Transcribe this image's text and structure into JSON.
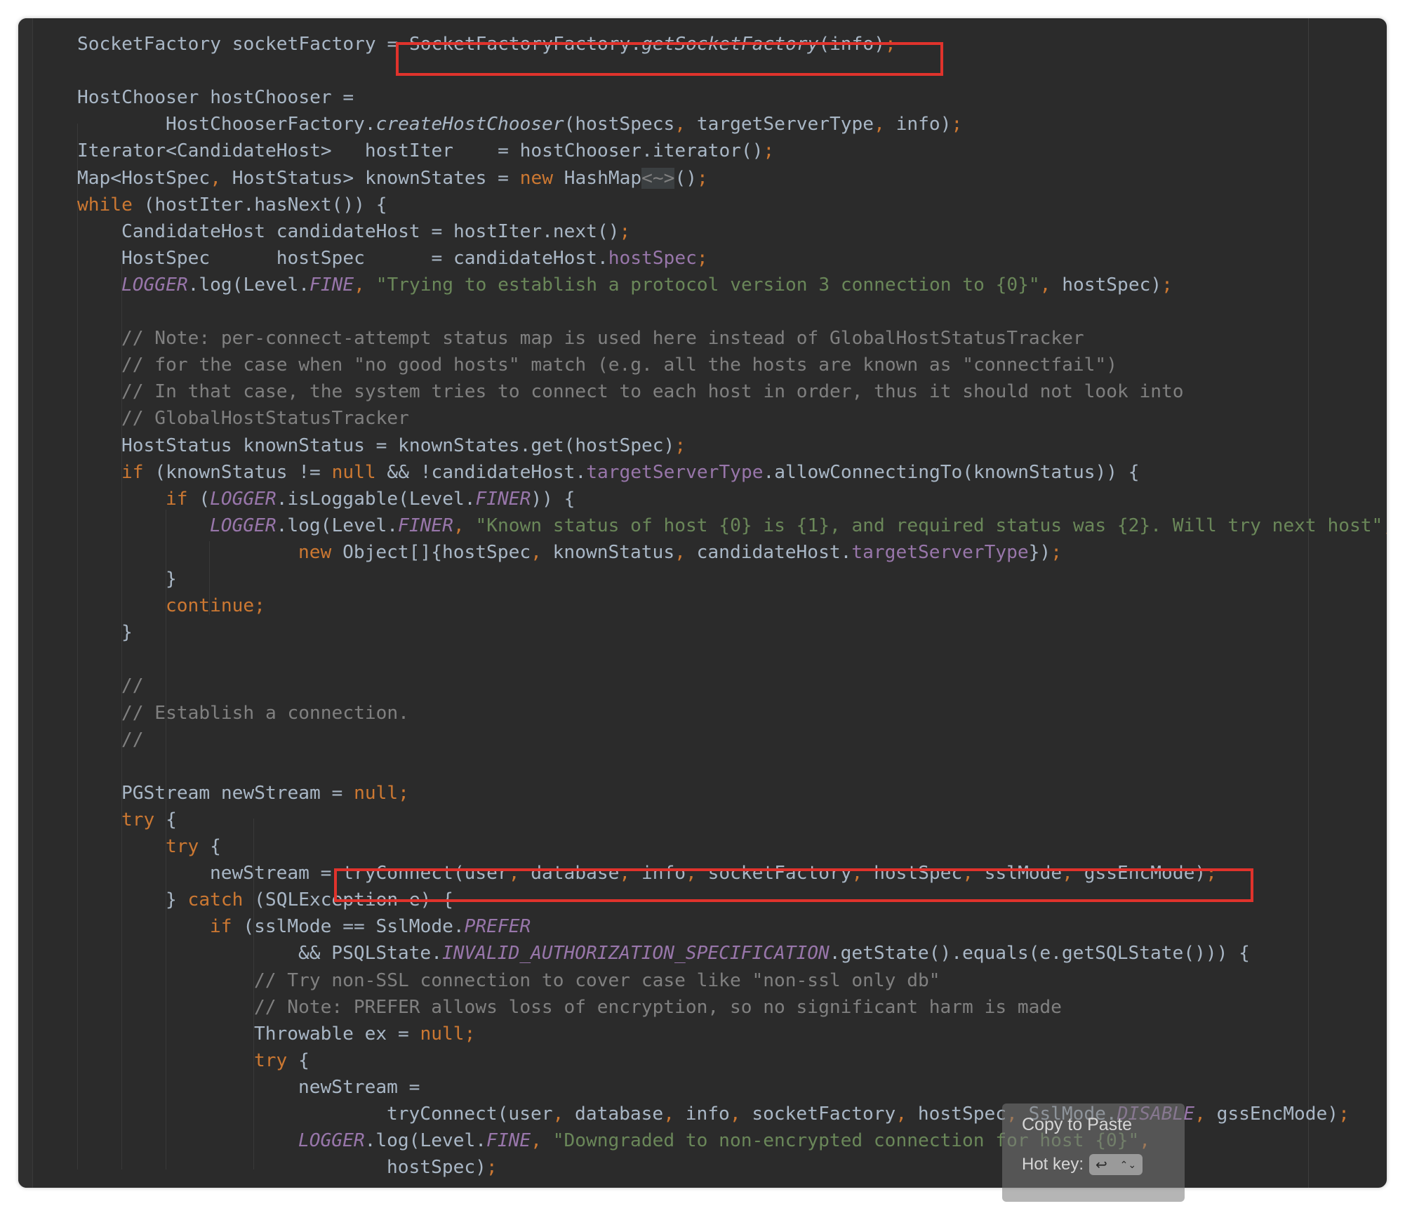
{
  "editor": {
    "lines": [
      {
        "indent": 0,
        "tokens": [
          [
            "SocketFactory socketFactory = ",
            ""
          ],
          [
            "SocketFactoryFactory.",
            ""
          ],
          [
            "getSocketFactory",
            "smeth"
          ],
          [
            "(info)",
            ""
          ],
          [
            ";",
            "kw"
          ]
        ]
      },
      {
        "indent": 0,
        "tokens": []
      },
      {
        "indent": 0,
        "tokens": [
          [
            "HostChooser hostChooser =",
            ""
          ]
        ]
      },
      {
        "indent": 2,
        "tokens": [
          [
            "HostChooserFactory.",
            ""
          ],
          [
            "createHostChooser",
            "smeth"
          ],
          [
            "(hostSpecs",
            ""
          ],
          [
            ",",
            "kw"
          ],
          [
            " targetServerType",
            ""
          ],
          [
            ",",
            "kw"
          ],
          [
            " info)",
            ""
          ],
          [
            ";",
            "kw"
          ]
        ]
      },
      {
        "indent": 0,
        "tokens": [
          [
            "Iterator<CandidateHost>   hostIter    = hostChooser.iterator()",
            ""
          ],
          [
            ";",
            "kw"
          ]
        ]
      },
      {
        "indent": 0,
        "tokens": [
          [
            "Map<HostSpec",
            ""
          ],
          [
            ",",
            "kw"
          ],
          [
            " HostStatus> knownStates = ",
            ""
          ],
          [
            "new",
            "kw"
          ],
          [
            " HashMap",
            ""
          ],
          [
            "<~>",
            "diamond"
          ],
          [
            "()",
            ""
          ],
          [
            ";",
            "kw"
          ]
        ]
      },
      {
        "indent": 0,
        "tokens": [
          [
            "while",
            "kw"
          ],
          [
            " (hostIter.hasNext()) {",
            ""
          ]
        ]
      },
      {
        "indent": 1,
        "tokens": [
          [
            "CandidateHost candidateHost = hostIter.next()",
            ""
          ],
          [
            ";",
            "kw"
          ]
        ]
      },
      {
        "indent": 1,
        "tokens": [
          [
            "HostSpec      hostSpec      = candidateHost.",
            ""
          ],
          [
            "hostSpec",
            "fld"
          ],
          [
            ";",
            "kw"
          ]
        ]
      },
      {
        "indent": 1,
        "tokens": [
          [
            "LOGGER",
            "sfld"
          ],
          [
            ".log(Level.",
            ""
          ],
          [
            "FINE",
            "sfld"
          ],
          [
            ",",
            "kw"
          ],
          [
            " ",
            ""
          ],
          [
            "\"Trying to establish a protocol version 3 connection to {0}\"",
            "str"
          ],
          [
            ",",
            "kw"
          ],
          [
            " hostSpec)",
            ""
          ],
          [
            ";",
            "kw"
          ]
        ]
      },
      {
        "indent": 0,
        "tokens": []
      },
      {
        "indent": 1,
        "tokens": [
          [
            "// Note: per-connect-attempt status map is used here instead of GlobalHostStatusTracker",
            "cmt"
          ]
        ]
      },
      {
        "indent": 1,
        "tokens": [
          [
            "// for the case when \"no good hosts\" match (e.g. all the hosts are known as \"connectfail\")",
            "cmt"
          ]
        ]
      },
      {
        "indent": 1,
        "tokens": [
          [
            "// In that case, the system tries to connect to each host in order, thus it should not look into",
            "cmt"
          ]
        ]
      },
      {
        "indent": 1,
        "tokens": [
          [
            "// GlobalHostStatusTracker",
            "cmt"
          ]
        ]
      },
      {
        "indent": 1,
        "tokens": [
          [
            "HostStatus knownStatus = knownStates.get(hostSpec)",
            ""
          ],
          [
            ";",
            "kw"
          ]
        ]
      },
      {
        "indent": 1,
        "tokens": [
          [
            "if",
            "kw"
          ],
          [
            " (knownStatus != ",
            ""
          ],
          [
            "null",
            "kw"
          ],
          [
            " && !candidateHost.",
            ""
          ],
          [
            "targetServerType",
            "fld"
          ],
          [
            ".allowConnectingTo(knownStatus)) {",
            ""
          ]
        ]
      },
      {
        "indent": 2,
        "tokens": [
          [
            "if",
            "kw"
          ],
          [
            " (",
            ""
          ],
          [
            "LOGGER",
            "sfld"
          ],
          [
            ".isLoggable(Level.",
            ""
          ],
          [
            "FINER",
            "sfld"
          ],
          [
            ")) {",
            ""
          ]
        ]
      },
      {
        "indent": 3,
        "tokens": [
          [
            "LOGGER",
            "sfld"
          ],
          [
            ".log(Level.",
            ""
          ],
          [
            "FINER",
            "sfld"
          ],
          [
            ",",
            "kw"
          ],
          [
            " ",
            ""
          ],
          [
            "\"Known status of host {0} is {1}, and required status was {2}. Will try next host\"",
            "str"
          ],
          [
            ",",
            "kw"
          ]
        ]
      },
      {
        "indent": 5,
        "tokens": [
          [
            "new",
            "kw"
          ],
          [
            " Object[]{hostSpec",
            ""
          ],
          [
            ",",
            "kw"
          ],
          [
            " knownStatus",
            ""
          ],
          [
            ",",
            "kw"
          ],
          [
            " candidateHost.",
            ""
          ],
          [
            "targetServerType",
            "fld"
          ],
          [
            "})",
            ""
          ],
          [
            ";",
            "kw"
          ]
        ]
      },
      {
        "indent": 2,
        "tokens": [
          [
            "}",
            ""
          ]
        ]
      },
      {
        "indent": 2,
        "tokens": [
          [
            "continue;",
            "kw"
          ]
        ]
      },
      {
        "indent": 1,
        "tokens": [
          [
            "}",
            ""
          ]
        ]
      },
      {
        "indent": 0,
        "tokens": []
      },
      {
        "indent": 1,
        "tokens": [
          [
            "//",
            "cmt"
          ]
        ]
      },
      {
        "indent": 1,
        "tokens": [
          [
            "// Establish a connection.",
            "cmt"
          ]
        ]
      },
      {
        "indent": 1,
        "tokens": [
          [
            "//",
            "cmt"
          ]
        ]
      },
      {
        "indent": 0,
        "tokens": []
      },
      {
        "indent": 1,
        "tokens": [
          [
            "PGStream newStream = ",
            ""
          ],
          [
            "null;",
            "kw"
          ]
        ]
      },
      {
        "indent": 1,
        "tokens": [
          [
            "try",
            "kw"
          ],
          [
            " {",
            ""
          ]
        ]
      },
      {
        "indent": 2,
        "tokens": [
          [
            "try",
            "kw"
          ],
          [
            " {",
            ""
          ]
        ]
      },
      {
        "indent": 3,
        "tokens": [
          [
            "newStream = tryConnect(user",
            ""
          ],
          [
            ",",
            "kw"
          ],
          [
            " database",
            ""
          ],
          [
            ",",
            "kw"
          ],
          [
            " info",
            ""
          ],
          [
            ",",
            "kw"
          ],
          [
            " socketFactory",
            ""
          ],
          [
            ",",
            "kw"
          ],
          [
            " hostSpec",
            ""
          ],
          [
            ",",
            "kw"
          ],
          [
            " sslMode",
            ""
          ],
          [
            ",",
            "kw"
          ],
          [
            " gssEncMode)",
            ""
          ],
          [
            ";",
            "kw"
          ]
        ]
      },
      {
        "indent": 2,
        "tokens": [
          [
            "} ",
            ""
          ],
          [
            "catch",
            "kw"
          ],
          [
            " (SQLException e) {",
            ""
          ]
        ]
      },
      {
        "indent": 3,
        "tokens": [
          [
            "if",
            "kw"
          ],
          [
            " (sslMode == SslMode.",
            ""
          ],
          [
            "PREFER",
            "sfld"
          ]
        ]
      },
      {
        "indent": 5,
        "tokens": [
          [
            "&& PSQLState.",
            ""
          ],
          [
            "INVALID_AUTHORIZATION_SPECIFICATION",
            "sfld"
          ],
          [
            ".getState().equals(e.getSQLState())) {",
            ""
          ]
        ]
      },
      {
        "indent": 4,
        "tokens": [
          [
            "// Try non-SSL connection to cover case like \"non-ssl only db\"",
            "cmt"
          ]
        ]
      },
      {
        "indent": 4,
        "tokens": [
          [
            "// Note: PREFER allows loss of encryption, so no significant harm is made",
            "cmt"
          ]
        ]
      },
      {
        "indent": 4,
        "tokens": [
          [
            "Throwable ex = ",
            ""
          ],
          [
            "null;",
            "kw"
          ]
        ]
      },
      {
        "indent": 4,
        "tokens": [
          [
            "try",
            "kw"
          ],
          [
            " {",
            ""
          ]
        ]
      },
      {
        "indent": 5,
        "tokens": [
          [
            "newStream =",
            ""
          ]
        ]
      },
      {
        "indent": 7,
        "tokens": [
          [
            "tryConnect(user",
            ""
          ],
          [
            ",",
            "kw"
          ],
          [
            " database",
            ""
          ],
          [
            ",",
            "kw"
          ],
          [
            " info",
            ""
          ],
          [
            ",",
            "kw"
          ],
          [
            " socketFactory",
            ""
          ],
          [
            ",",
            "kw"
          ],
          [
            " hostSpec",
            ""
          ],
          [
            ",",
            "kw"
          ],
          [
            " SslMode.",
            ""
          ],
          [
            "DISABLE",
            "sfld"
          ],
          [
            ",",
            "kw"
          ],
          [
            " gssEncMode)",
            ""
          ],
          [
            ";",
            "kw"
          ]
        ]
      },
      {
        "indent": 5,
        "tokens": [
          [
            "LOGGER",
            "sfld"
          ],
          [
            ".log(Level.",
            ""
          ],
          [
            "FINE",
            "sfld"
          ],
          [
            ",",
            "kw"
          ],
          [
            " ",
            ""
          ],
          [
            "\"Downgraded to non-encrypted connection for host {0}\"",
            "str"
          ],
          [
            ",",
            "kw"
          ]
        ]
      },
      {
        "indent": 7,
        "tokens": [
          [
            "hostSpec)",
            ""
          ],
          [
            ";",
            "kw"
          ]
        ]
      }
    ]
  },
  "tooltip": {
    "title": "Copy to Paste",
    "hotkey_label": "Hot key:",
    "key_symbol": "↩",
    "key_arrows": "⌃⌄"
  },
  "colors": {
    "background": "#2b2b2b",
    "text": "#a9b7c6",
    "keyword": "#cc7832",
    "string": "#6a8759",
    "comment": "#808080",
    "field": "#9876aa",
    "highlight_box": "#e0332c"
  }
}
